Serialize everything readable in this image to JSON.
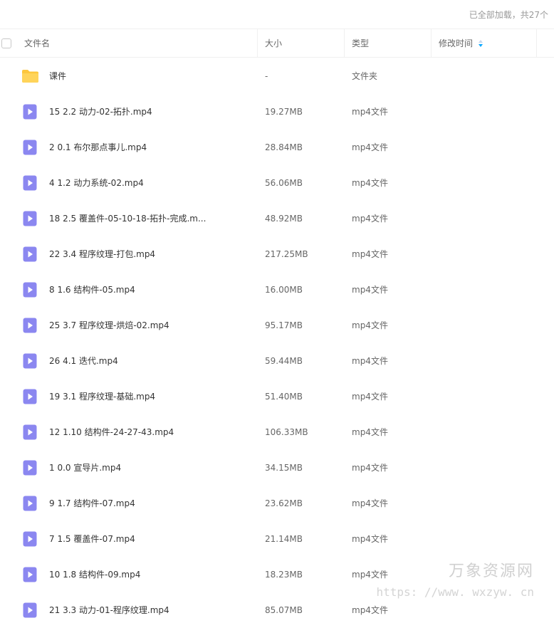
{
  "status": "已全部加载，共27个",
  "columns": {
    "name": "文件名",
    "size": "大小",
    "type": "类型",
    "modified": "修改时间"
  },
  "rows": [
    {
      "name": "课件",
      "size": "-",
      "type": "文件夹",
      "icon": "folder-icon"
    },
    {
      "name": "15 2.2 动力-02-拓扑.mp4",
      "size": "19.27MB",
      "type": "mp4文件",
      "icon": "video-file-icon"
    },
    {
      "name": "2 0.1 布尔那点事儿.mp4",
      "size": "28.84MB",
      "type": "mp4文件",
      "icon": "video-file-icon"
    },
    {
      "name": "4 1.2 动力系统-02.mp4",
      "size": "56.06MB",
      "type": "mp4文件",
      "icon": "video-file-icon"
    },
    {
      "name": "18 2.5 覆盖件-05-10-18-拓扑-完成.m...",
      "size": "48.92MB",
      "type": "mp4文件",
      "icon": "video-file-icon"
    },
    {
      "name": "22 3.4 程序纹理-打包.mp4",
      "size": "217.25MB",
      "type": "mp4文件",
      "icon": "video-file-icon"
    },
    {
      "name": "8 1.6 结构件-05.mp4",
      "size": "16.00MB",
      "type": "mp4文件",
      "icon": "video-file-icon"
    },
    {
      "name": "25 3.7 程序纹理-烘焙-02.mp4",
      "size": "95.17MB",
      "type": "mp4文件",
      "icon": "video-file-icon"
    },
    {
      "name": "26 4.1 迭代.mp4",
      "size": "59.44MB",
      "type": "mp4文件",
      "icon": "video-file-icon"
    },
    {
      "name": "19 3.1 程序纹理-基础.mp4",
      "size": "51.40MB",
      "type": "mp4文件",
      "icon": "video-file-icon"
    },
    {
      "name": "12 1.10 结构件-24-27-43.mp4",
      "size": "106.33MB",
      "type": "mp4文件",
      "icon": "video-file-icon"
    },
    {
      "name": "1 0.0 宣导片.mp4",
      "size": "34.15MB",
      "type": "mp4文件",
      "icon": "video-file-icon"
    },
    {
      "name": "9 1.7 结构件-07.mp4",
      "size": "23.62MB",
      "type": "mp4文件",
      "icon": "video-file-icon"
    },
    {
      "name": "7 1.5 覆盖件-07.mp4",
      "size": "21.14MB",
      "type": "mp4文件",
      "icon": "video-file-icon"
    },
    {
      "name": "10 1.8 结构件-09.mp4",
      "size": "18.23MB",
      "type": "mp4文件",
      "icon": "video-file-icon"
    },
    {
      "name": "21 3.3 动力-01-程序纹理.mp4",
      "size": "85.07MB",
      "type": "mp4文件",
      "icon": "video-file-icon"
    }
  ],
  "watermark": {
    "line1": "万象资源网",
    "line2": "https: //www. wxzyw. cn"
  },
  "colors": {
    "video_icon": "#8b87f0",
    "folder_icon": "#fdc73d",
    "sort_active": "#06a7ff",
    "border": "#f0f0f0",
    "text_secondary": "#999999"
  }
}
